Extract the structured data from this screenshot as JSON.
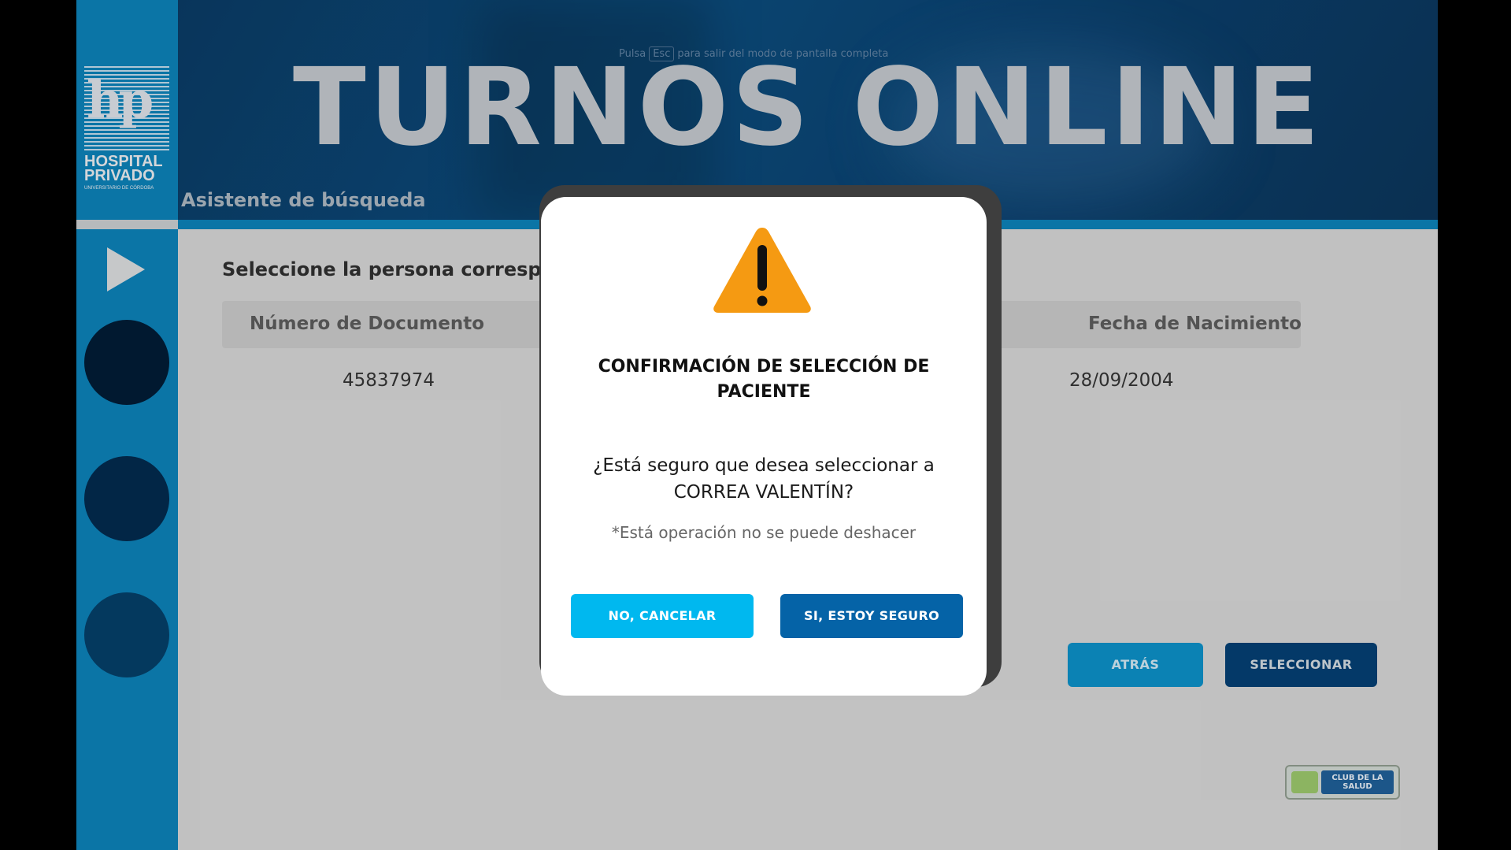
{
  "colors": {
    "sidebar": "#0d7fb5",
    "header_bg": "#0b4a7a",
    "circle_1": "#021c35",
    "circle_2": "#032a4c",
    "circle_3": "#053e66",
    "btn_cancel": "#00b8ef",
    "btn_confirm": "#0563a7",
    "btn_back": "#0d8ec4",
    "btn_select": "#053e71",
    "warning": "#f59a12"
  },
  "sidebar": {
    "logo": {
      "monogram": "hp",
      "name": "HOSPITAL PRIVADO",
      "subtitle": "UNIVERSITARIO DE CÓRDOBA"
    },
    "play_icon": "play-icon"
  },
  "header": {
    "title": "TURNOS ONLINE",
    "subtitle": "Asistente de búsqueda",
    "esc_hint": {
      "before": "Pulsa",
      "key": "Esc",
      "after": "para salir del modo de pantalla completa"
    }
  },
  "content": {
    "prompt": "Seleccione la persona correspo",
    "columns": [
      "Número de Documento",
      "Fecha de Nacimiento"
    ],
    "row": {
      "documento": "45837974",
      "fecha": "28/09/2004"
    },
    "buttons": {
      "back": "ATRÁS",
      "select": "SELECCIONAR"
    },
    "club_logo": "CLUB DE LA SALUD"
  },
  "modal": {
    "icon": "warning-icon",
    "title": "CONFIRMACIÓN DE SELECCIÓN DE PACIENTE",
    "question_line1": "¿Está seguro que desea seleccionar a",
    "question_line2": "CORREA VALENTÍN?",
    "note": "*Está operación no se puede deshacer",
    "cancel_label": "NO, CANCELAR",
    "confirm_label": "SI, ESTOY SEGURO"
  }
}
